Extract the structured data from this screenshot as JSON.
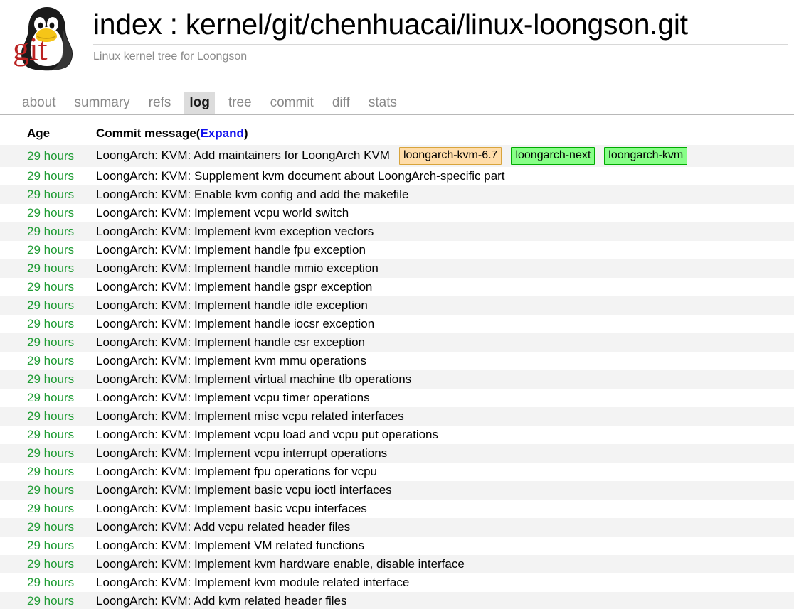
{
  "header": {
    "logo_alt": "cgit-tux-git-logo",
    "title": "index : kernel/git/chenhuacai/linux-loongson.git",
    "subtitle": "Linux kernel tree for Loongson"
  },
  "nav": {
    "tabs": [
      {
        "label": "about",
        "active": false
      },
      {
        "label": "summary",
        "active": false
      },
      {
        "label": "refs",
        "active": false
      },
      {
        "label": "log",
        "active": true
      },
      {
        "label": "tree",
        "active": false
      },
      {
        "label": "commit",
        "active": false
      },
      {
        "label": "diff",
        "active": false
      },
      {
        "label": "stats",
        "active": false
      }
    ]
  },
  "log": {
    "columns": {
      "age": "Age",
      "message": "Commit message",
      "message_suffix_open": "(",
      "expand_label": "Expand",
      "message_suffix_close": ")"
    },
    "rows": [
      {
        "age": "29 hours",
        "message": "LoongArch: KVM: Add maintainers for LoongArch KVM",
        "decorations": [
          {
            "label": "loongarch-kvm-6.7",
            "kind": "tag"
          },
          {
            "label": "loongarch-next",
            "kind": "branch"
          },
          {
            "label": "loongarch-kvm",
            "kind": "branch"
          }
        ]
      },
      {
        "age": "29 hours",
        "message": "LoongArch: KVM: Supplement kvm document about LoongArch-specific part",
        "decorations": []
      },
      {
        "age": "29 hours",
        "message": "LoongArch: KVM: Enable kvm config and add the makefile",
        "decorations": []
      },
      {
        "age": "29 hours",
        "message": "LoongArch: KVM: Implement vcpu world switch",
        "decorations": []
      },
      {
        "age": "29 hours",
        "message": "LoongArch: KVM: Implement kvm exception vectors",
        "decorations": []
      },
      {
        "age": "29 hours",
        "message": "LoongArch: KVM: Implement handle fpu exception",
        "decorations": []
      },
      {
        "age": "29 hours",
        "message": "LoongArch: KVM: Implement handle mmio exception",
        "decorations": []
      },
      {
        "age": "29 hours",
        "message": "LoongArch: KVM: Implement handle gspr exception",
        "decorations": []
      },
      {
        "age": "29 hours",
        "message": "LoongArch: KVM: Implement handle idle exception",
        "decorations": []
      },
      {
        "age": "29 hours",
        "message": "LoongArch: KVM: Implement handle iocsr exception",
        "decorations": []
      },
      {
        "age": "29 hours",
        "message": "LoongArch: KVM: Implement handle csr exception",
        "decorations": []
      },
      {
        "age": "29 hours",
        "message": "LoongArch: KVM: Implement kvm mmu operations",
        "decorations": []
      },
      {
        "age": "29 hours",
        "message": "LoongArch: KVM: Implement virtual machine tlb operations",
        "decorations": []
      },
      {
        "age": "29 hours",
        "message": "LoongArch: KVM: Implement vcpu timer operations",
        "decorations": []
      },
      {
        "age": "29 hours",
        "message": "LoongArch: KVM: Implement misc vcpu related interfaces",
        "decorations": []
      },
      {
        "age": "29 hours",
        "message": "LoongArch: KVM: Implement vcpu load and vcpu put operations",
        "decorations": []
      },
      {
        "age": "29 hours",
        "message": "LoongArch: KVM: Implement vcpu interrupt operations",
        "decorations": []
      },
      {
        "age": "29 hours",
        "message": "LoongArch: KVM: Implement fpu operations for vcpu",
        "decorations": []
      },
      {
        "age": "29 hours",
        "message": "LoongArch: KVM: Implement basic vcpu ioctl interfaces",
        "decorations": []
      },
      {
        "age": "29 hours",
        "message": "LoongArch: KVM: Implement basic vcpu interfaces",
        "decorations": []
      },
      {
        "age": "29 hours",
        "message": "LoongArch: KVM: Add vcpu related header files",
        "decorations": []
      },
      {
        "age": "29 hours",
        "message": "LoongArch: KVM: Implement VM related functions",
        "decorations": []
      },
      {
        "age": "29 hours",
        "message": "LoongArch: KVM: Implement kvm hardware enable, disable interface",
        "decorations": []
      },
      {
        "age": "29 hours",
        "message": "LoongArch: KVM: Implement kvm module related interface",
        "decorations": []
      },
      {
        "age": "29 hours",
        "message": "LoongArch: KVM: Add kvm related header files",
        "decorations": []
      }
    ]
  },
  "colors": {
    "age_green": "#1f9b34",
    "link_blue": "#1010ee",
    "tag_bg": "#ffddaa",
    "tag_border": "#d8a43c",
    "branch_bg": "#88ff88",
    "branch_border": "#00aa00",
    "active_tab_bg": "#dcdcdc",
    "row_alt_bg": "#f3f3f3"
  }
}
